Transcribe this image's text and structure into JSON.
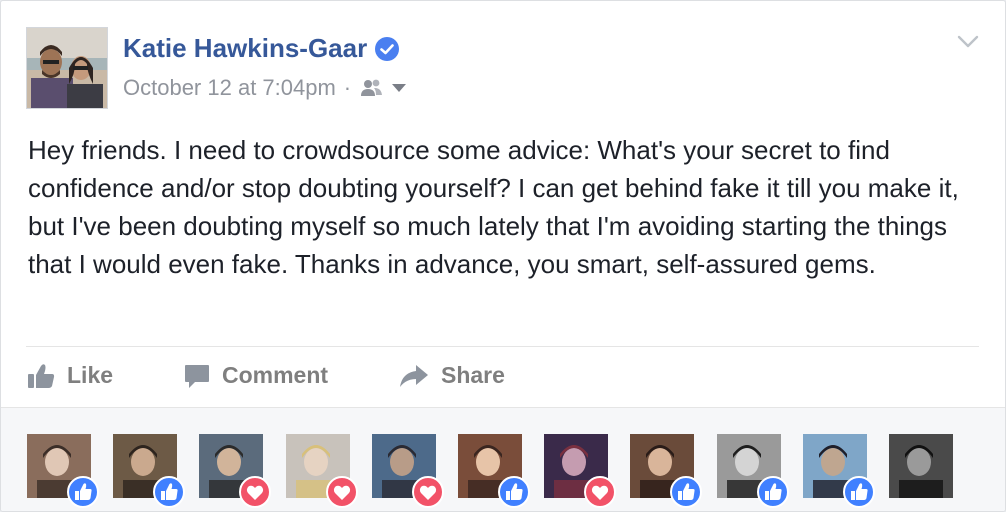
{
  "post": {
    "author": "Katie Hawkins-Gaar",
    "timestamp": "October 12 at 7:04pm",
    "separator": "·",
    "text": "Hey friends. I need to crowdsource some advice: What's your secret to find confidence and/or stop doubting yourself? I can get behind fake it till you make it, but I've been doubting myself so much lately that I'm avoiding starting the things that I would even fake. Thanks in advance, you smart, self-assured gems."
  },
  "icons": {
    "verified": "verified-badge-icon",
    "audience": "friends-audience-icon",
    "audience_caret": "caret-down-icon",
    "menu": "chevron-down-icon",
    "like": "thumbs-up-icon",
    "comment": "speech-bubble-icon",
    "share": "share-arrow-icon"
  },
  "actions": {
    "like": "Like",
    "comment": "Comment",
    "share": "Share"
  },
  "reactors": [
    {
      "reaction": "like"
    },
    {
      "reaction": "like"
    },
    {
      "reaction": "love"
    },
    {
      "reaction": "love"
    },
    {
      "reaction": "love"
    },
    {
      "reaction": "like"
    },
    {
      "reaction": "love"
    },
    {
      "reaction": "like"
    },
    {
      "reaction": "like"
    },
    {
      "reaction": "like"
    },
    {
      "reaction": "none"
    }
  ],
  "colors": {
    "author_link": "#365899",
    "meta_gray": "#90949c",
    "body_text": "#1d2129",
    "action_gray": "#7f7f7f",
    "like_blue": "#4080ff",
    "love_red": "#f25268",
    "verified_blue": "#4a7ff0"
  }
}
